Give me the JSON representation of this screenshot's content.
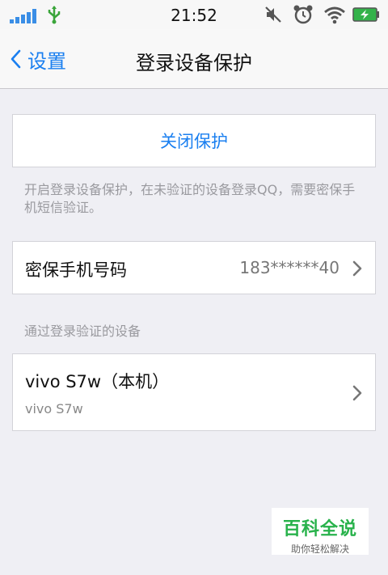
{
  "status_bar": {
    "time": "21:52",
    "icons": [
      "signal-icon",
      "usb-icon",
      "mute-icon",
      "alarm-icon",
      "wifi-icon",
      "battery-charging-icon"
    ]
  },
  "nav": {
    "back_label": "设置",
    "title": "登录设备保护"
  },
  "protection": {
    "close_label": "关闭保护",
    "note": "开启登录设备保护，在未验证的设备登录QQ，需要密保手机短信验证。"
  },
  "phone": {
    "label": "密保手机号码",
    "value": "183******40"
  },
  "devices": {
    "header": "通过登录验证的设备",
    "items": [
      {
        "name": "vivo S7w（本机）",
        "model": "vivo S7w"
      }
    ]
  },
  "watermark": {
    "title": "百科全说",
    "subtitle": "助你轻松解决"
  },
  "colors": {
    "accent": "#1a7ff0",
    "background": "#efeff4",
    "watermark_green": "#28b24b"
  }
}
